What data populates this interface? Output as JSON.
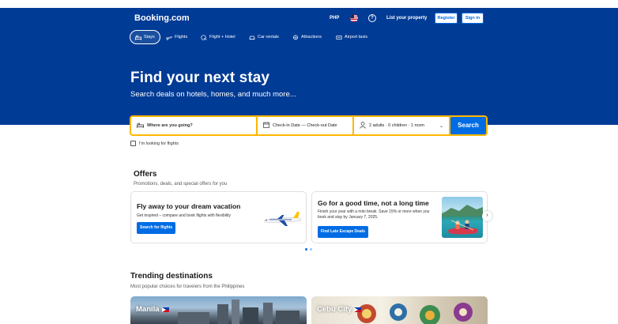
{
  "header": {
    "logo": "Booking.com",
    "currency": "PHP",
    "list_property": "List your property",
    "register": "Register",
    "sign_in": "Sign in"
  },
  "nav": {
    "items": [
      {
        "label": "Stays",
        "icon": "bed-icon"
      },
      {
        "label": "Flights",
        "icon": "plane-icon"
      },
      {
        "label": "Flight + Hotel",
        "icon": "flight-hotel-icon"
      },
      {
        "label": "Car rentals",
        "icon": "car-icon"
      },
      {
        "label": "Attractions",
        "icon": "attractions-icon"
      },
      {
        "label": "Airport taxis",
        "icon": "taxi-icon"
      }
    ]
  },
  "hero": {
    "title": "Find your next stay",
    "subtitle": "Search deals on hotels, homes, and much more..."
  },
  "search": {
    "destination_placeholder": "Where are you going?",
    "dates": "Check-in Date — Check-out Date",
    "guests": "2 adults · 0 children · 1 room",
    "button": "Search",
    "flights_checkbox": "I'm looking for flights"
  },
  "offers": {
    "title": "Offers",
    "subtitle": "Promotions, deals, and special offers for you",
    "cards": [
      {
        "title": "Fly away to your dream vacation",
        "desc": "Get inspired – compare and book flights with flexibility",
        "button": "Search for flights"
      },
      {
        "title": "Go for a good time, not a long time",
        "desc": "Finish your year with a mini break. Save 15% or more when you book and stay by January 7, 2025.",
        "button": "Find Late Escape Deals"
      }
    ]
  },
  "trending": {
    "title": "Trending destinations",
    "subtitle": "Most popular choices for travelers from the Philippines",
    "destinations": [
      "Manila",
      "Cebu City"
    ]
  },
  "colors": {
    "brand_blue": "#003b95",
    "accent_blue": "#006ce4",
    "search_border": "#ffb700"
  }
}
